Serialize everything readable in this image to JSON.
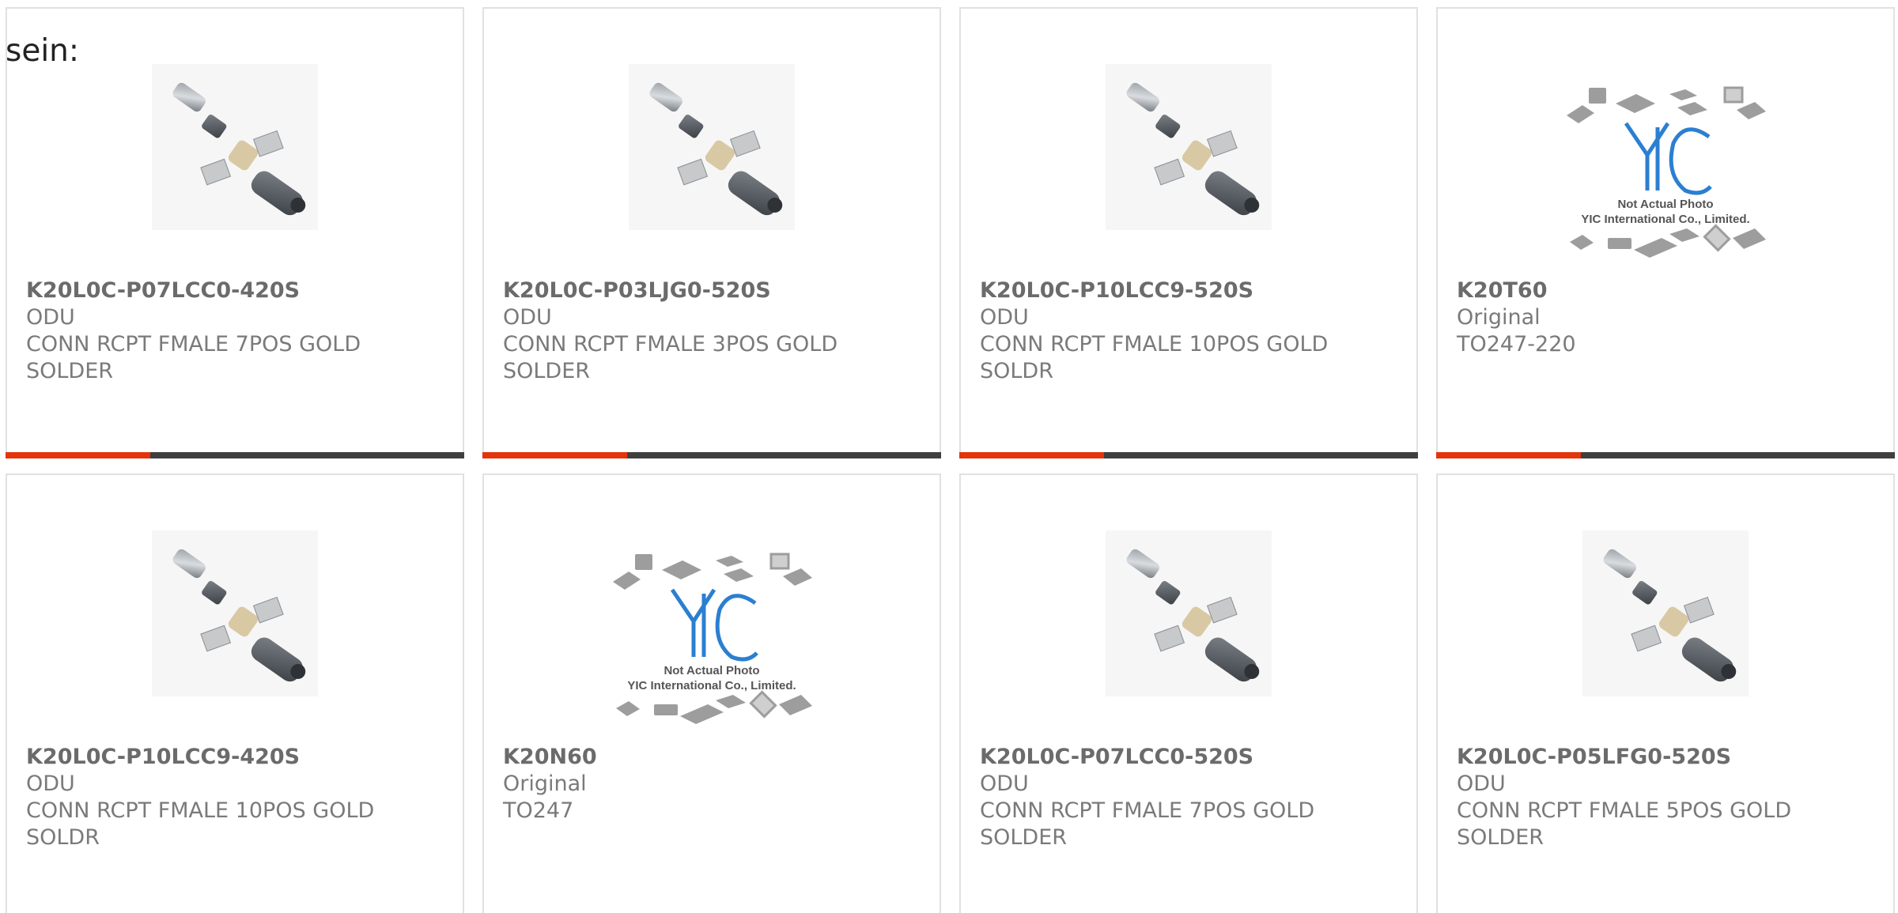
{
  "intro": {
    "text": "sein:"
  },
  "colors": {
    "accent": "#e5330c",
    "bar": "#3f3f3f",
    "border": "#e1e1e1",
    "text": "#7a7a7a"
  },
  "cards": [
    {
      "part": "K20L0C-P07LCC0-420S",
      "brand": "ODU",
      "desc": "CONN RCPT FMALE 7POS GOLD SOLDER",
      "image": "connector-parts-photo"
    },
    {
      "part": "K20L0C-P03LJG0-520S",
      "brand": "ODU",
      "desc": "CONN RCPT FMALE 3POS GOLD SOLDER",
      "image": "connector-parts-photo"
    },
    {
      "part": "K20L0C-P10LCC9-520S",
      "brand": "ODU",
      "desc": "CONN RCPT FMALE 10POS GOLD SOLDR",
      "image": "connector-parts-photo"
    },
    {
      "part": "K20T60",
      "brand": "Original",
      "desc": "TO247-220",
      "image": "yic-placeholder",
      "placeholder_lines": [
        "Not Actual Photo",
        "YIC International Co., Limited."
      ]
    },
    {
      "part": "K20L0C-P10LCC9-420S",
      "brand": "ODU",
      "desc": "CONN RCPT FMALE 10POS GOLD SOLDR",
      "image": "connector-parts-photo"
    },
    {
      "part": "K20N60",
      "brand": "Original",
      "desc": "TO247",
      "image": "yic-placeholder",
      "placeholder_lines": [
        "Not Actual Photo",
        "YIC International Co., Limited."
      ]
    },
    {
      "part": "K20L0C-P07LCC0-520S",
      "brand": "ODU",
      "desc": "CONN RCPT FMALE 7POS GOLD SOLDER",
      "image": "connector-parts-photo"
    },
    {
      "part": "K20L0C-P05LFG0-520S",
      "brand": "ODU",
      "desc": "CONN RCPT FMALE 5POS GOLD SOLDER",
      "image": "connector-parts-photo"
    }
  ]
}
